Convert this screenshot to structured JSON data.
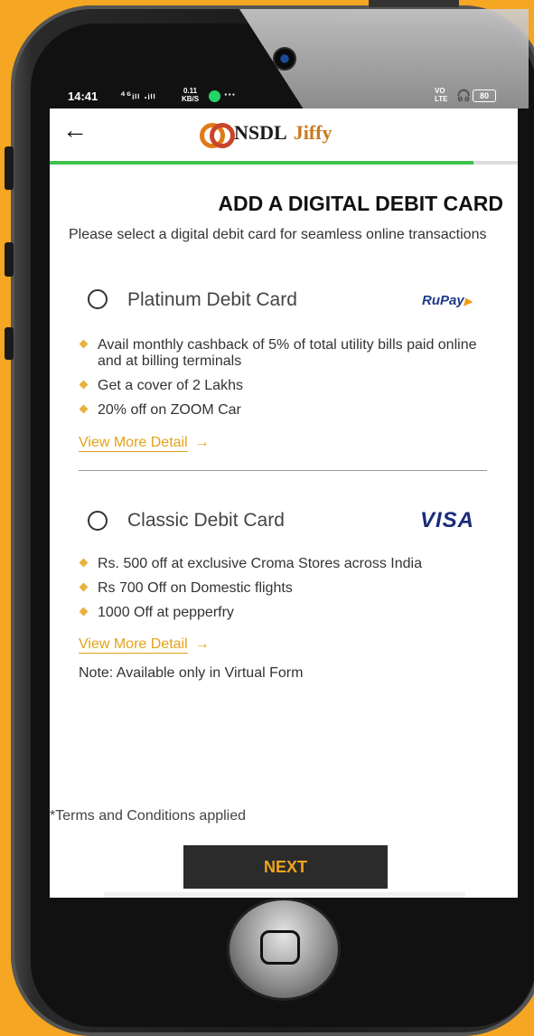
{
  "status_bar": {
    "time": "14:41",
    "signal": "⁴⁶ᵢₗₗ .ᵢₗₗ",
    "net_speed": "0.11",
    "net_unit": "KB/S",
    "more": "···",
    "volte_top": "VO",
    "volte_bottom": "LTE",
    "battery": "80"
  },
  "app": {
    "back_icon": "←",
    "brand": "NSDL",
    "brand_suffix": "Jiffy",
    "progress_fraction": 0.905,
    "accent_color": "#3cc24d"
  },
  "page": {
    "title": "ADD A DIGITAL DEBIT CARD",
    "subtitle": "Please select a digital debit card for seamless online transactions"
  },
  "cards": [
    {
      "name": "Platinum Debit Card",
      "network": "RuPay",
      "features": [
        "Avail monthly cashback of 5% of total utility bills paid online and at billing terminals",
        "Get a cover of 2 Lakhs",
        "20% off on ZOOM Car"
      ],
      "more_label": "View More Detail",
      "more_arrow": "→"
    },
    {
      "name": "Classic Debit Card",
      "network": "VISA",
      "features": [
        "Rs. 500 off at exclusive Croma Stores across India",
        "Rs 700 Off on Domestic flights",
        "1000 Off at pepperfry"
      ],
      "more_label": "View More Detail",
      "more_arrow": "→",
      "note": "Note: Available only in Virtual Form"
    }
  ],
  "footer": {
    "terms": "*Terms and Conditions applied",
    "next_label": "NEXT"
  },
  "colors": {
    "background": "#f5a623",
    "link": "#e3a21a",
    "button_bg": "#2b2b2b",
    "button_text": "#f0a51a"
  }
}
